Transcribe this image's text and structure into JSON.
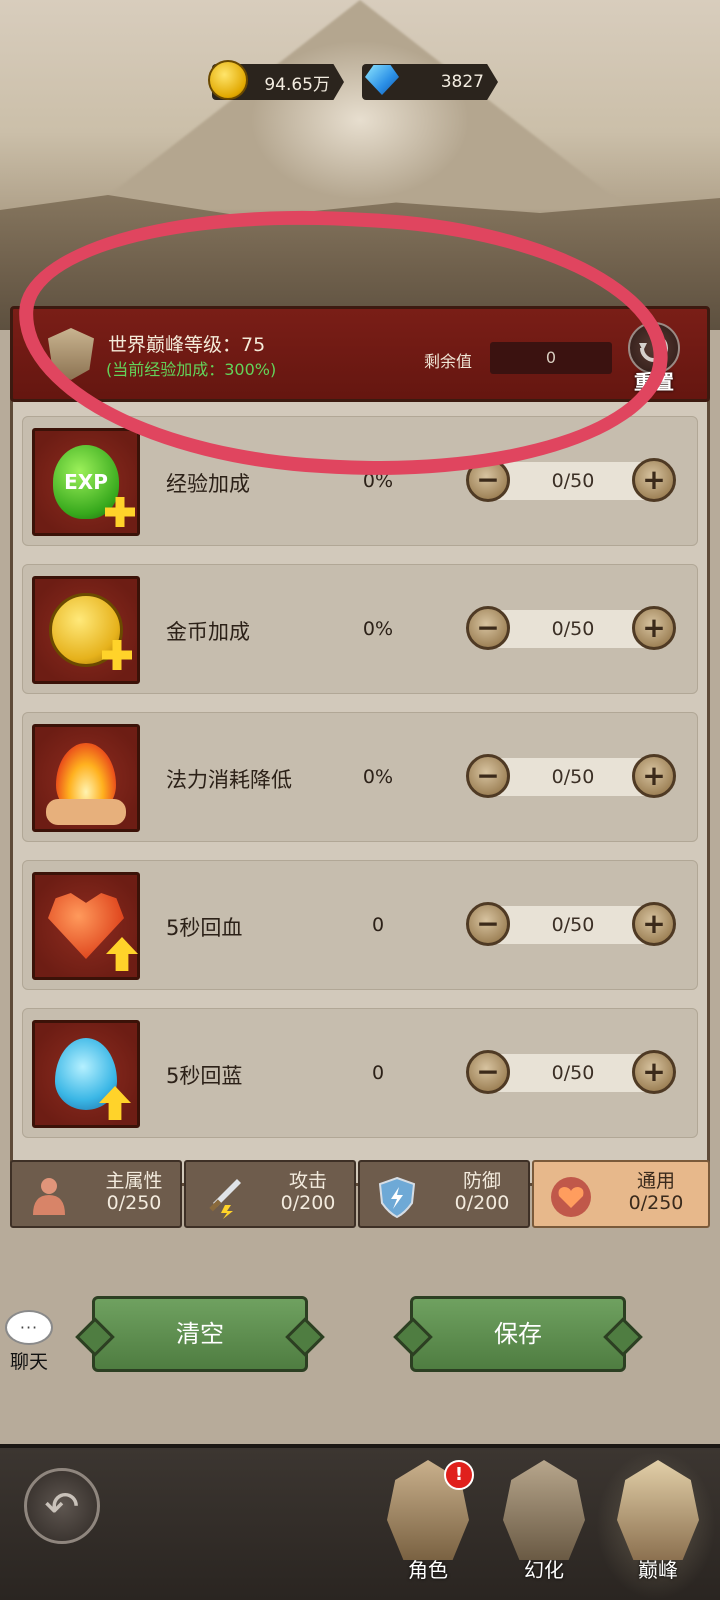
{
  "currency": {
    "gold": "94.65万",
    "gems": "3827"
  },
  "header": {
    "title": "世界巅峰等级：75",
    "subtitle": "(当前经验加成：300%)",
    "remain_label": "剩余值",
    "remain_value": "0",
    "reset_label": "重置"
  },
  "rows": [
    {
      "name": "经验加成",
      "value": "0%",
      "progress": "0/50",
      "icon": "exp-bonus-icon"
    },
    {
      "name": "金币加成",
      "value": "0%",
      "progress": "0/50",
      "icon": "gold-bonus-icon"
    },
    {
      "name": "法力消耗降低",
      "value": "0%",
      "progress": "0/50",
      "icon": "mana-cost-icon"
    },
    {
      "name": "5秒回血",
      "value": "0",
      "progress": "0/50",
      "icon": "hp-regen-icon"
    },
    {
      "name": "5秒回蓝",
      "value": "0",
      "progress": "0/50",
      "icon": "mp-regen-icon"
    }
  ],
  "tabs": [
    {
      "title": "主属性",
      "count": "0/250",
      "icon": "body-icon"
    },
    {
      "title": "攻击",
      "count": "0/200",
      "icon": "sword-icon"
    },
    {
      "title": "防御",
      "count": "0/200",
      "icon": "shield-icon"
    },
    {
      "title": "通用",
      "count": "0/250",
      "icon": "heart-icon",
      "active": true
    }
  ],
  "buttons": {
    "clear": "清空",
    "save": "保存"
  },
  "chat": {
    "bubble": "···",
    "label": "聊天"
  },
  "nav": {
    "back_icon": "↶",
    "items": [
      {
        "label": "角色",
        "icon": "helmet-icon",
        "badge": "!"
      },
      {
        "label": "幻化",
        "icon": "transform-icon"
      },
      {
        "label": "巅峰",
        "icon": "peak-icon",
        "active": true
      }
    ]
  },
  "colors": {
    "header_red": "#7a1e17",
    "exp_green": "#63d35a",
    "annotation": "#e0455f",
    "button_green": "#5f8f50",
    "active_tab": "#e7b88b"
  }
}
